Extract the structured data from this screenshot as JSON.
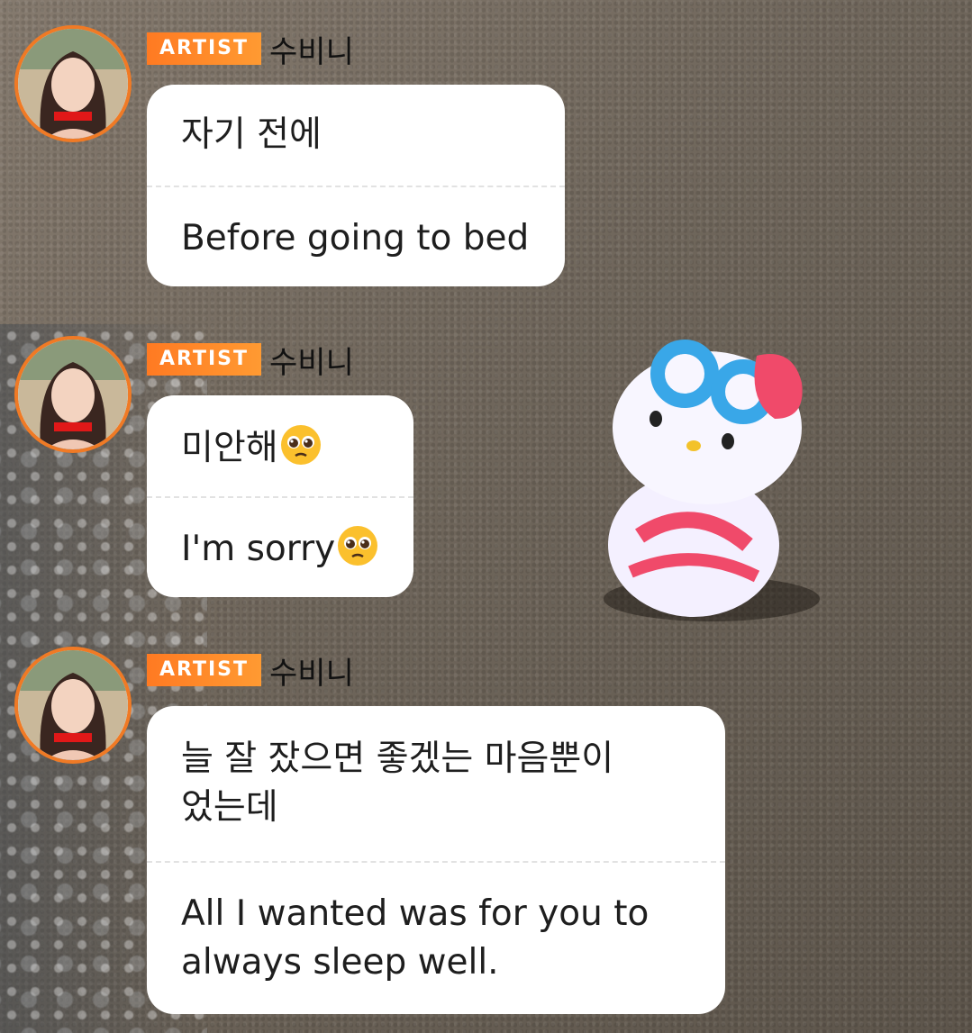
{
  "messages": [
    {
      "badge": "ARTIST",
      "author": "수비니",
      "original": "자기 전에",
      "translation": "Before going to bed"
    },
    {
      "badge": "ARTIST",
      "author": "수비니",
      "original": "미안해",
      "original_emoji": "pleading-face",
      "translation": "I'm sorry",
      "translation_emoji": "pleading-face"
    },
    {
      "badge": "ARTIST",
      "author": "수비니",
      "original_line1": "늘 잘 잤으면 좋겠는 마음뿐이",
      "original_line2": "었는데",
      "translation_line1": "All I wanted was for you to",
      "translation_line2": "always sleep well."
    }
  ],
  "colors": {
    "badge_orange": "#ff7a22",
    "avatar_ring": "#f07a25",
    "bubble": "#ffffff"
  }
}
